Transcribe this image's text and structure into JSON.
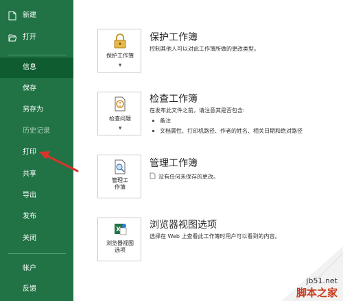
{
  "sidebar": {
    "new": "新建",
    "open": "打开",
    "items": [
      {
        "label": "信息",
        "state": "active"
      },
      {
        "label": "保存",
        "state": "normal"
      },
      {
        "label": "另存为",
        "state": "normal"
      },
      {
        "label": "历史记录",
        "state": "muted"
      },
      {
        "label": "打印",
        "state": "normal"
      },
      {
        "label": "共享",
        "state": "normal"
      },
      {
        "label": "导出",
        "state": "normal"
      },
      {
        "label": "发布",
        "state": "normal"
      },
      {
        "label": "关闭",
        "state": "normal"
      }
    ],
    "account": "帐户",
    "feedback": "反馈"
  },
  "sections": {
    "protect": {
      "button": "保护工作簿",
      "icon": "lock-key-icon",
      "title": "保护工作簿",
      "desc": "控制其他人可以对此工作簿所做的更改类型。"
    },
    "inspect": {
      "button": "检查问题",
      "icon": "inspect-document-icon",
      "title": "检查工作簿",
      "desc": "在发布此文件之前，请注意其是否包含:",
      "bullets": [
        "备注",
        "文档属性、打印机路径、作者的姓名、相关日期和绝对路径"
      ]
    },
    "manage": {
      "button": "管理工\n作簿",
      "icon": "manage-workbook-icon",
      "title": "管理工作簿",
      "desc": "没有任何未保存的更改。"
    },
    "browser": {
      "button": "浏览器视图\n选项",
      "icon": "excel-browser-icon",
      "title": "浏览器视图选项",
      "desc": "选择在 Web 上查看此工作簿时用户可以看到的内容。"
    }
  },
  "watermark": {
    "site": "jb51.net",
    "name": "脚本之家"
  },
  "colors": {
    "sidebar": "#217346",
    "active": "#0e5c2f",
    "arrow": "#d9342b"
  }
}
